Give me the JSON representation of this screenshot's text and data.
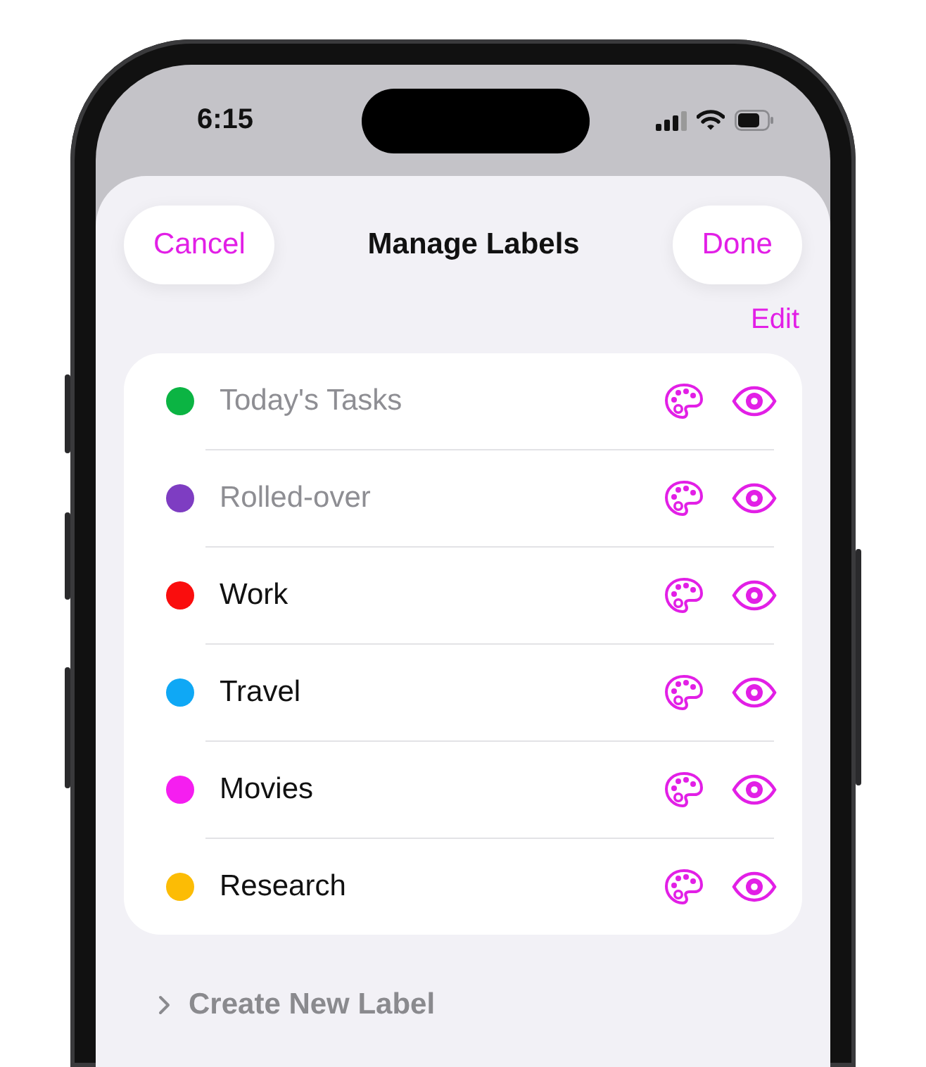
{
  "status_bar": {
    "time": "6:15"
  },
  "header": {
    "cancel": "Cancel",
    "title": "Manage Labels",
    "done": "Done"
  },
  "edit": "Edit",
  "labels": [
    {
      "name": "Today's Tasks",
      "color": "#0bb443",
      "disabled": true
    },
    {
      "name": "Rolled-over",
      "color": "#7e3dc2",
      "disabled": true
    },
    {
      "name": "Work",
      "color": "#fa0d0d",
      "disabled": false
    },
    {
      "name": "Travel",
      "color": "#0fa8f5",
      "disabled": false
    },
    {
      "name": "Movies",
      "color": "#f51ef0",
      "disabled": false
    },
    {
      "name": "Research",
      "color": "#fcbc05",
      "disabled": false
    }
  ],
  "create": "Create New Label"
}
